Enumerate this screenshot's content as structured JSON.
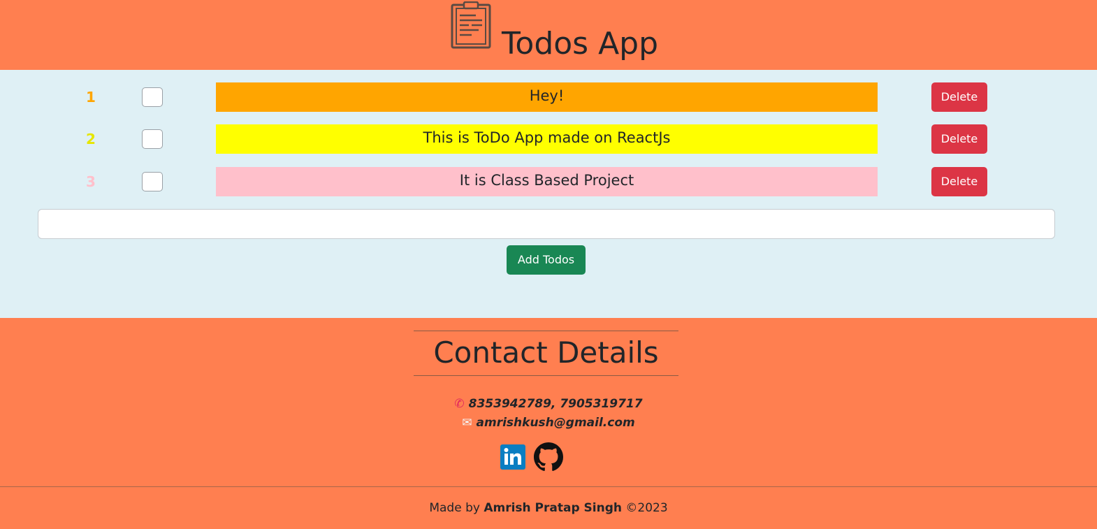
{
  "header": {
    "title": "Todos App",
    "logo_icon": "clipboard-icon"
  },
  "todos": [
    {
      "number": "1",
      "text": "Hey!",
      "checked": false,
      "color": "#ffa500",
      "delete_label": "Delete"
    },
    {
      "number": "2",
      "text": "This is ToDo App made on ReactJs",
      "checked": false,
      "color": "#ffff00",
      "delete_label": "Delete"
    },
    {
      "number": "3",
      "text": "It is Class Based Project",
      "checked": false,
      "color": "#ffc0cb",
      "delete_label": "Delete"
    }
  ],
  "new_todo": {
    "value": "",
    "placeholder": ""
  },
  "add_button_label": "Add Todos",
  "footer": {
    "contact_title": "Contact Details",
    "phone": "8353942789, 7905319717",
    "email": "amrishkush@gmail.com",
    "social_icons": [
      "linkedin-icon",
      "github-icon"
    ],
    "credits_prefix": "Made by",
    "author": "Amrish Pratap Singh",
    "copyright": "©2023"
  },
  "colors": {
    "header_bg": "#ff7f50",
    "main_bg": "#dff0f5",
    "delete_bg": "#dc3545",
    "add_bg": "#198754"
  }
}
